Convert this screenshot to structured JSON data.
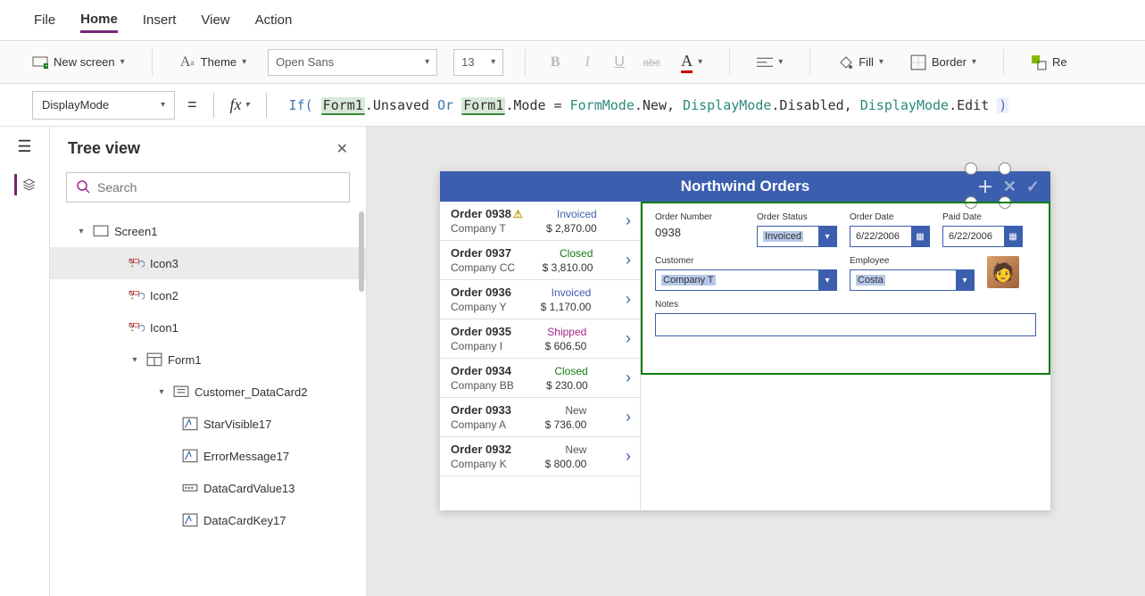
{
  "menu": {
    "file": "File",
    "home": "Home",
    "insert": "Insert",
    "view": "View",
    "action": "Action"
  },
  "ribbon": {
    "newscreen": "New screen",
    "theme": "Theme",
    "font": "Open Sans",
    "size": "13",
    "fill": "Fill",
    "border": "Border",
    "reorder": "Re"
  },
  "formula": {
    "property": "DisplayMode",
    "tokens": {
      "if": "If(",
      "form1a": "Form1",
      "unsaved": ".Unsaved",
      "or": "Or",
      "form1b": "Form1",
      "mode": ".Mode",
      "eq": "=",
      "formmode": "FormMode",
      "new": ".New,",
      "dm1": "DisplayMode",
      "disabled": ".Disabled,",
      "dm2": "DisplayMode",
      "edit": ".Edit",
      "close": ")"
    }
  },
  "tree": {
    "title": "Tree view",
    "search_ph": "Search",
    "nodes": {
      "screen1": "Screen1",
      "icon3": "Icon3",
      "icon2": "Icon2",
      "icon1": "Icon1",
      "form1": "Form1",
      "customer_dc": "Customer_DataCard2",
      "starvisible": "StarVisible17",
      "errormsg": "ErrorMessage17",
      "dcvalue": "DataCardValue13",
      "dckey": "DataCardKey17"
    }
  },
  "app": {
    "title": "Northwind Orders",
    "orders": [
      {
        "num": "Order 0938",
        "warn": true,
        "cust": "Company T",
        "status": "Invoiced",
        "amt": "$ 2,870.00"
      },
      {
        "num": "Order 0937",
        "warn": false,
        "cust": "Company CC",
        "status": "Closed",
        "amt": "$ 3,810.00"
      },
      {
        "num": "Order 0936",
        "warn": false,
        "cust": "Company Y",
        "status": "Invoiced",
        "amt": "$ 1,170.00"
      },
      {
        "num": "Order 0935",
        "warn": false,
        "cust": "Company I",
        "status": "Shipped",
        "amt": "$ 606.50"
      },
      {
        "num": "Order 0934",
        "warn": false,
        "cust": "Company BB",
        "status": "Closed",
        "amt": "$ 230.00"
      },
      {
        "num": "Order 0933",
        "warn": false,
        "cust": "Company A",
        "status": "New",
        "amt": "$ 736.00"
      },
      {
        "num": "Order 0932",
        "warn": false,
        "cust": "Company K",
        "status": "New",
        "amt": "$ 800.00"
      }
    ],
    "form": {
      "ordernum_label": "Order Number",
      "ordernum": "0938",
      "orderstatus_label": "Order Status",
      "orderstatus": "Invoiced",
      "orderdate_label": "Order Date",
      "orderdate": "6/22/2006",
      "paiddate_label": "Paid Date",
      "paiddate": "6/22/2006",
      "customer_label": "Customer",
      "customer": "Company T",
      "employee_label": "Employee",
      "employee": "Costa",
      "notes_label": "Notes"
    }
  }
}
